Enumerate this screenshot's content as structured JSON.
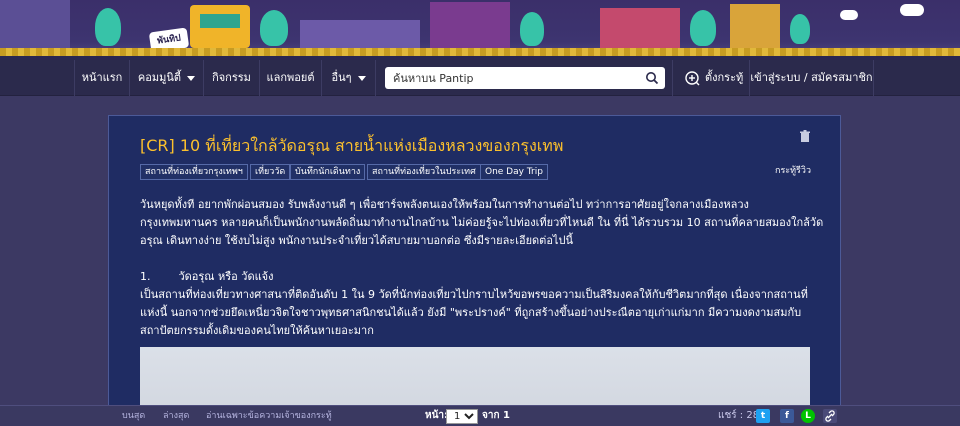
{
  "banner": {
    "badge_text": "พันทิป"
  },
  "nav": {
    "items": [
      {
        "label": "หน้าแรก",
        "has_caret": false
      },
      {
        "label": "คอมมูนิตี้",
        "has_caret": true
      },
      {
        "label": "กิจกรรม",
        "has_caret": false
      },
      {
        "label": "แลกพอยต์",
        "has_caret": false
      },
      {
        "label": "อื่นๆ",
        "has_caret": true
      }
    ],
    "search_placeholder": "ค้นหาบน Pantip",
    "create_topic": "ตั้งกระทู้",
    "login": "เข้าสู่ระบบ / สมัครสมาชิก"
  },
  "post": {
    "title": "[CR] 10 ที่เที่ยวใกล้วัดอรุณ สายน้ำแห่งเมืองหลวงของกรุงเทพ",
    "type_label": "กระทู้รีวิว",
    "tags": [
      "สถานที่ท่องเที่ยวกรุงเทพฯ",
      "เที่ยววัด",
      "บันทึกนักเดินทาง",
      "สถานที่ท่องเที่ยวในประเทศ",
      "One Day Trip"
    ],
    "intro_lines": [
      "วันหยุดทั้งที อยากพักผ่อนสมอง รับพลังงานดี ๆ เพื่อชาร์จพลังตนเองให้พร้อมในการทำงานต่อไป ทว่าการอาศัยอยู่ใจกลางเมืองหลวง",
      "กรุงเทพมหานคร หลายคนก็เป็นพนักงานพลัดถิ่นมาทำงานไกลบ้าน ไม่ค่อยรู้จะไปท่องเที่ยวที่ไหนดี ใน ที่นี่ ได้รวบรวม 10 สถานที่คลายสมองใกล้วัด",
      "อรุณ เดินทางง่าย ใช้งบไม่สูง พนักงานประจำเที่ยวได้สบายมาบอกต่อ ซึ่งมีรายละเอียดต่อไปนี้"
    ],
    "section_heading": "1.        วัดอรุณ หรือ วัดแจ้ง",
    "section_lines": [
      "เป็นสถานที่ท่องเที่ยวทางศาสนาที่ติดอันดับ 1 ใน 9 วัดที่นักท่องเที่ยวไปกราบไหว้ขอพรขอความเป็นสิริมงคลให้กับชีวิตมากที่สุด เนื่องจากสถานที่",
      "แห่งนี้ นอกจากช่วยยึดเหนี่ยวจิตใจชาวพุทธศาสนิกชนได้แล้ว ยังมี \"พระปรางค์\" ที่ถูกสร้างขึ้นอย่างประณีตอายุเก่าแก่มาก มีความงดงามสมกับ",
      "สถาปัตยกรรมดั้งเดิมของคนไทยให้ค้นหาเยอะมาก"
    ]
  },
  "footer": {
    "links": [
      "บนสุด",
      "ล่างสุด",
      "อ่านเฉพาะข้อความเจ้าของกระทู้"
    ],
    "page_label": "หน้า:",
    "page_value": "1",
    "page_total": "จาก 1",
    "share_label": "แชร์ : 28"
  },
  "colors": {
    "title": "#fbc02d",
    "card_bg": "#1f2c63",
    "nav_bg": "#2b2a4c",
    "page_bg": "#3c3963"
  }
}
